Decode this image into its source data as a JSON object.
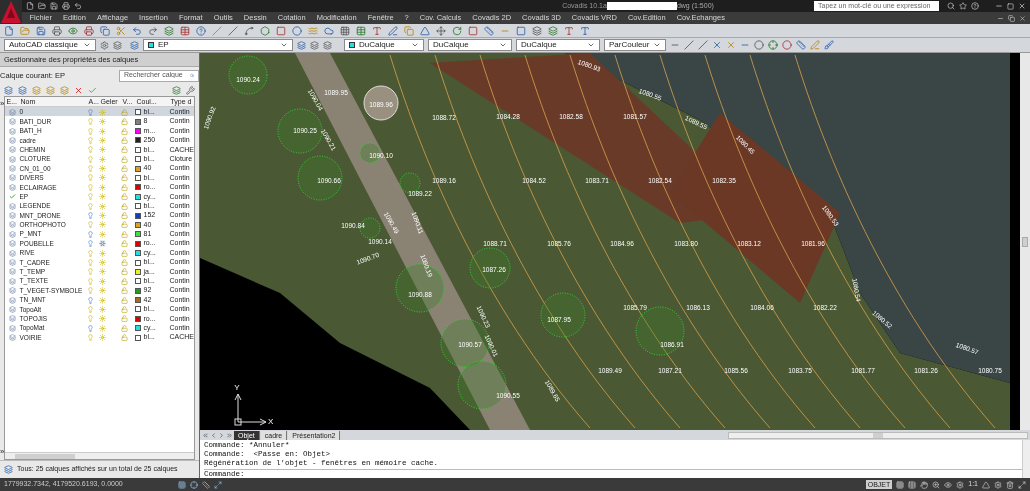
{
  "window": {
    "title_prefix": "Covadis 10.1a",
    "title_suffix": "dwg (1:500)"
  },
  "search": {
    "placeholder": "Tapez un mot-clé ou une expression"
  },
  "menu": [
    "Fichier",
    "Edition",
    "Affichage",
    "Insertion",
    "Format",
    "Outils",
    "Dessin",
    "Cotation",
    "Modification",
    "Fenêtre",
    "?",
    "Cov. Calculs",
    "Covadis 2D",
    "Covadis 3D",
    "Covadis VRD",
    "Cov.Edition",
    "Cov.Echanges"
  ],
  "toolbar": {
    "workspace": "AutoCAD classique",
    "layer": "EP",
    "color_setting": "DuCalque",
    "linetype": "DuCalque",
    "lineweight": "DuCalque",
    "plot_style": "ParCouleur"
  },
  "layer_panel": {
    "title": "Gestionnaire des propriétés des calques",
    "current_label": "Calque courant: EP",
    "search_placeholder": "Rechercher calque",
    "expand_glyphs": [
      "»",
      "»"
    ],
    "columns": [
      "E...",
      "Nom",
      "A...",
      "Geler",
      "V...",
      "Coul...",
      "Type d"
    ],
    "layers": [
      {
        "name": "0",
        "on": false,
        "frozen": false,
        "color": "#ffffff",
        "color_name": "bl...",
        "linetype": "Contin",
        "selected": true,
        "current": false
      },
      {
        "name": "BATI_DUR",
        "on": true,
        "frozen": false,
        "color": "#808080",
        "color_name": "8",
        "linetype": "Contin",
        "selected": false,
        "current": false
      },
      {
        "name": "BATI_H",
        "on": true,
        "frozen": false,
        "color": "#ff00ff",
        "color_name": "m...",
        "linetype": "Contin",
        "selected": false,
        "current": false
      },
      {
        "name": "cadre",
        "on": true,
        "frozen": false,
        "color": "#222222",
        "color_name": "250",
        "linetype": "Contin",
        "selected": false,
        "current": false
      },
      {
        "name": "CHEMIN",
        "on": true,
        "frozen": false,
        "color": "#ffffff",
        "color_name": "bl...",
        "linetype": "CACHE",
        "selected": false,
        "current": false
      },
      {
        "name": "CLOTURE",
        "on": true,
        "frozen": false,
        "color": "#ffffff",
        "color_name": "bl...",
        "linetype": "Cloture",
        "selected": false,
        "current": false
      },
      {
        "name": "CN_01_00",
        "on": true,
        "frozen": false,
        "color": "#e0a020",
        "color_name": "40",
        "linetype": "Contin",
        "selected": false,
        "current": false
      },
      {
        "name": "DIVERS",
        "on": true,
        "frozen": false,
        "color": "#ffffff",
        "color_name": "bl...",
        "linetype": "Contin",
        "selected": false,
        "current": false
      },
      {
        "name": "ECLAIRAGE",
        "on": true,
        "frozen": false,
        "color": "#e00000",
        "color_name": "ro...",
        "linetype": "Contin",
        "selected": false,
        "current": false
      },
      {
        "name": "EP",
        "on": true,
        "frozen": false,
        "color": "#20e0e0",
        "color_name": "cy...",
        "linetype": "Contin",
        "selected": false,
        "current": true
      },
      {
        "name": "LEGENDE",
        "on": true,
        "frozen": false,
        "color": "#ffffff",
        "color_name": "bl...",
        "linetype": "Contin",
        "selected": false,
        "current": false
      },
      {
        "name": "MNT_DRONE",
        "on": false,
        "frozen": false,
        "color": "#1040c0",
        "color_name": "152",
        "linetype": "Contin",
        "selected": false,
        "current": false
      },
      {
        "name": "ORTHOPHOTO",
        "on": true,
        "frozen": false,
        "color": "#e0a020",
        "color_name": "40",
        "linetype": "Contin",
        "selected": false,
        "current": false
      },
      {
        "name": "P_MNT",
        "on": false,
        "frozen": false,
        "color": "#40e040",
        "color_name": "81",
        "linetype": "Contin",
        "selected": false,
        "current": false
      },
      {
        "name": "POUBELLE",
        "on": false,
        "frozen": true,
        "color": "#e00000",
        "color_name": "ro...",
        "linetype": "Contin",
        "selected": false,
        "current": false
      },
      {
        "name": "RIVE",
        "on": true,
        "frozen": false,
        "color": "#20e0e0",
        "color_name": "cy...",
        "linetype": "Contin",
        "selected": false,
        "current": false
      },
      {
        "name": "T_CADRE",
        "on": true,
        "frozen": false,
        "color": "#ffffff",
        "color_name": "bl...",
        "linetype": "Contin",
        "selected": false,
        "current": false
      },
      {
        "name": "T_TEMP",
        "on": true,
        "frozen": false,
        "color": "#f0f020",
        "color_name": "ja...",
        "linetype": "Contin",
        "selected": false,
        "current": false
      },
      {
        "name": "T_TEXTE",
        "on": true,
        "frozen": false,
        "color": "#ffffff",
        "color_name": "bl...",
        "linetype": "Contin",
        "selected": false,
        "current": false
      },
      {
        "name": "T_VEGET-SYMBOLE",
        "on": true,
        "frozen": false,
        "color": "#20a020",
        "color_name": "92",
        "linetype": "Contin",
        "selected": false,
        "current": false
      },
      {
        "name": "TN_MNT",
        "on": false,
        "frozen": false,
        "color": "#a07020",
        "color_name": "42",
        "linetype": "Contin",
        "selected": false,
        "current": false
      },
      {
        "name": "TopoAlt",
        "on": true,
        "frozen": false,
        "color": "#ffffff",
        "color_name": "bl...",
        "linetype": "Contin",
        "selected": false,
        "current": false
      },
      {
        "name": "TOPOJIS",
        "on": true,
        "frozen": false,
        "color": "#e00000",
        "color_name": "ro...",
        "linetype": "Contin",
        "selected": false,
        "current": false
      },
      {
        "name": "TopoMat",
        "on": false,
        "frozen": false,
        "color": "#20e0e0",
        "color_name": "cy...",
        "linetype": "Contin",
        "selected": false,
        "current": false
      },
      {
        "name": "VOIRIE",
        "on": true,
        "frozen": false,
        "color": "#ffffff",
        "color_name": "bl...",
        "linetype": "CACHE",
        "selected": false,
        "current": false
      }
    ],
    "summary": "Tous: 25 calques affichés sur un total de 25 calques"
  },
  "drawing": {
    "spot_elevations": [
      "1090.24",
      "1089.95",
      "1089.96",
      "1088.72",
      "1084.28",
      "1082.58",
      "1081.57",
      "1090.25",
      "1090.10",
      "1090.66",
      "1089.16",
      "1084.52",
      "1083.71",
      "1082.54",
      "1082.35",
      "1089.22",
      "1090.84",
      "1090.14",
      "1088.71",
      "1085.76",
      "1084.96",
      "1083.80",
      "1083.12",
      "1081.96",
      "1087.26",
      "1090.88",
      "1085.79",
      "1086.13",
      "1084.06",
      "1082.22",
      "1087.95",
      "1090.57",
      "1086.91",
      "1089.49",
      "1087.21",
      "1085.56",
      "1083.75",
      "1081.77",
      "1081.26",
      "1080.75",
      "1090.55",
      "1090.92",
      "1090.04",
      "1090.21",
      "1090.49",
      "1090.11",
      "1090.70",
      "1090.19",
      "1090.23",
      "1090.01",
      "1089.65",
      "1080.93",
      "1080.55",
      "1089.55",
      "1080.45",
      "1080.53",
      "1080.54",
      "1080.52",
      "1080.57"
    ],
    "ucs": {
      "y_label": "Y",
      "x_label": "X"
    }
  },
  "layout_tabs": [
    {
      "label": "Objet",
      "selected": true
    },
    {
      "label": "cadre",
      "selected": false
    },
    {
      "label": "Présentation2",
      "selected": false
    }
  ],
  "command_history": [
    "Commande: *Annuler*",
    "Commande:  <Passe en: Objet>",
    "Régénération de l'objet - fenêtres en mémoire cache."
  ],
  "command_prompt": "Commande:",
  "status_bar": {
    "coordinates": "1779932.7342, 4179520.6193, 0.0000",
    "space": "OBJET",
    "annotation_scale": "1:1"
  }
}
